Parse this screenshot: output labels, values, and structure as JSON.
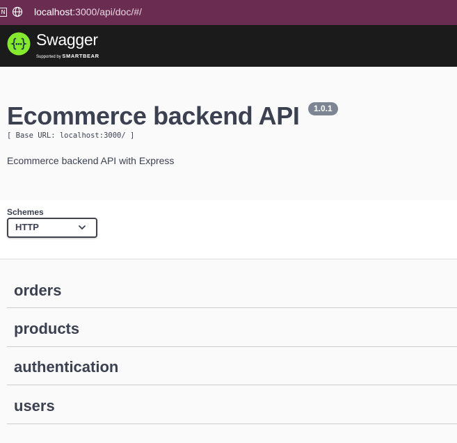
{
  "browser": {
    "tab_glyph": "N",
    "url_host": "localhost",
    "url_path": ":3000/api/doc/#/"
  },
  "topbar": {
    "brand": "Swagger",
    "supported_by": "Supported by",
    "company": "SMARTBEAR",
    "accent_color": "#85ea2d",
    "background": "#1b1b1b"
  },
  "info": {
    "title": "Ecommerce backend API",
    "version": "1.0.1",
    "base_url": "[ Base URL: localhost:3000/ ]",
    "description": "Ecommerce backend API with Express"
  },
  "schemes": {
    "label": "Schemes",
    "selected": "HTTP"
  },
  "tags": [
    {
      "label": "orders"
    },
    {
      "label": "products"
    },
    {
      "label": "authentication"
    },
    {
      "label": "users"
    }
  ]
}
